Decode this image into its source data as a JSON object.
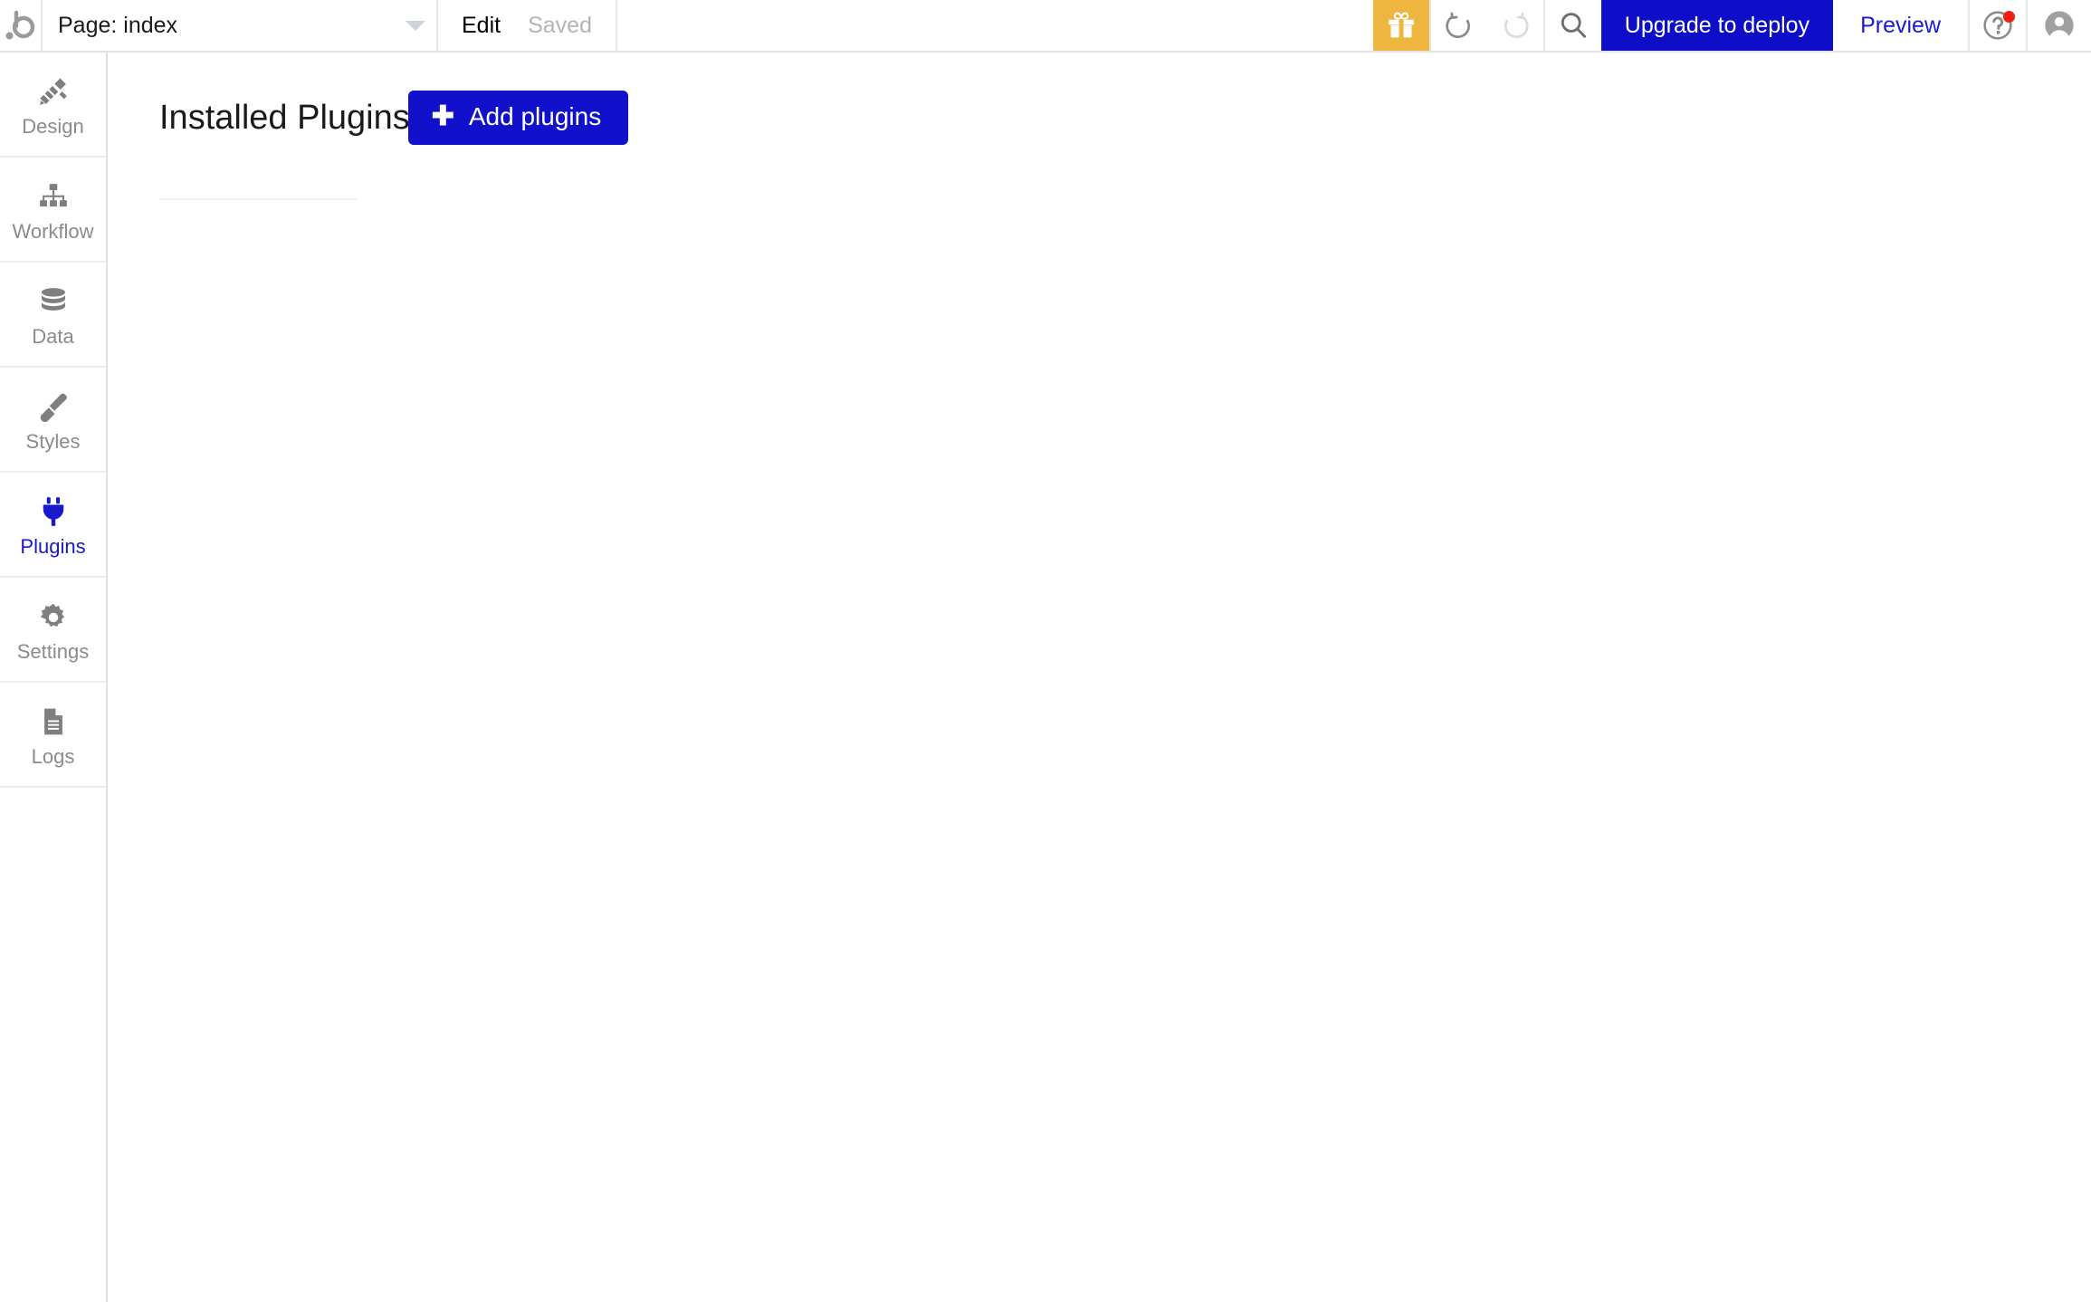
{
  "topbar": {
    "logo_icon": "bubble-logo-icon",
    "page_selector": {
      "label": "Page: index",
      "caret_icon": "chevron-down-icon"
    },
    "mode_label": "Edit",
    "save_status": "Saved",
    "gift_icon": "gift-icon",
    "undo_icon": "undo-icon",
    "redo_icon": "redo-icon",
    "search_icon": "search-icon",
    "upgrade_label": "Upgrade to deploy",
    "preview_label": "Preview",
    "help_icon": "question-mark-circle-icon",
    "avatar_icon": "user-avatar-icon"
  },
  "sidebar": {
    "items": [
      {
        "label": "Design",
        "icon": "design-pencil-ruler-icon",
        "active": false
      },
      {
        "label": "Workflow",
        "icon": "workflow-hierarchy-icon",
        "active": false
      },
      {
        "label": "Data",
        "icon": "database-icon",
        "active": false
      },
      {
        "label": "Styles",
        "icon": "paintbrush-icon",
        "active": false
      },
      {
        "label": "Plugins",
        "icon": "plug-icon",
        "active": true
      },
      {
        "label": "Settings",
        "icon": "gear-icon",
        "active": false
      },
      {
        "label": "Logs",
        "icon": "document-lines-icon",
        "active": false
      }
    ]
  },
  "main": {
    "title": "Installed Plugins",
    "add_plugins_label": "Add plugins",
    "add_plugins_plus": "✚"
  },
  "colors": {
    "accent_blue": "#1111cc",
    "gift_amber": "#eeb63f",
    "notification_red": "#ef1f12",
    "muted_text": "#8b8b8b"
  }
}
